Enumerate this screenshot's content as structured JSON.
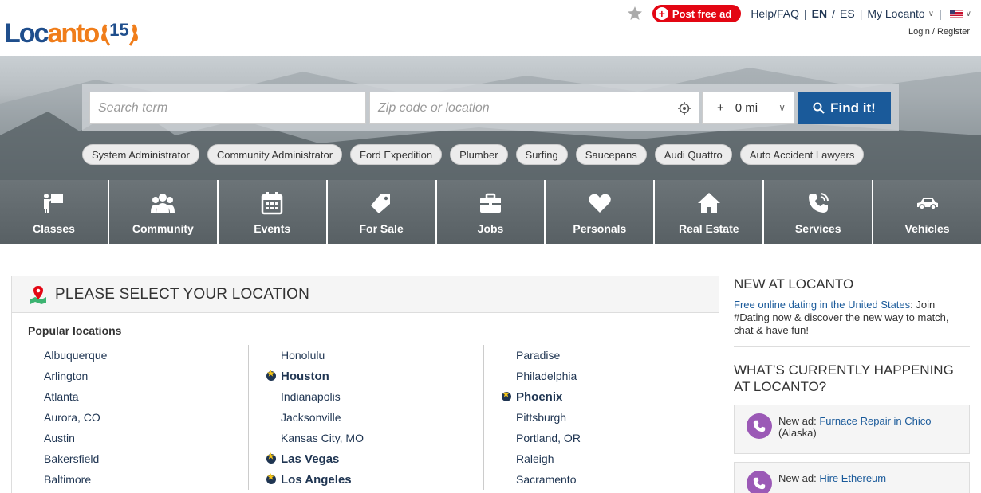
{
  "header": {
    "logo_word_a": "Loc",
    "logo_word_b": "anto",
    "logo_badge": "15",
    "post_ad": "Post free ad",
    "help": "Help/FAQ",
    "lang_en": "EN",
    "lang_es": "ES",
    "my_account": "My Locanto",
    "auth": "Login / Register"
  },
  "search": {
    "term_placeholder": "Search term",
    "location_placeholder": "Zip code or location",
    "radius_plus": "+",
    "radius": "0 mi",
    "button": "Find it!"
  },
  "chips": [
    "System Administrator",
    "Community Administrator",
    "Ford Expedition",
    "Plumber",
    "Surfing",
    "Saucepans",
    "Audi Quattro",
    "Auto Accident Lawyers"
  ],
  "categories": [
    {
      "label": "Classes",
      "icon": "classes-icon"
    },
    {
      "label": "Community",
      "icon": "community-icon"
    },
    {
      "label": "Events",
      "icon": "calendar-icon"
    },
    {
      "label": "For Sale",
      "icon": "tag-icon"
    },
    {
      "label": "Jobs",
      "icon": "briefcase-icon"
    },
    {
      "label": "Personals",
      "icon": "heart-icon"
    },
    {
      "label": "Real Estate",
      "icon": "house-icon"
    },
    {
      "label": "Services",
      "icon": "phone-icon"
    },
    {
      "label": "Vehicles",
      "icon": "car-icon"
    }
  ],
  "location": {
    "title": "PLEASE SELECT YOUR LOCATION",
    "popular": "Popular locations",
    "col1": [
      {
        "name": "Albuquerque",
        "featured": false
      },
      {
        "name": "Arlington",
        "featured": false
      },
      {
        "name": "Atlanta",
        "featured": false
      },
      {
        "name": "Aurora, CO",
        "featured": false
      },
      {
        "name": "Austin",
        "featured": false
      },
      {
        "name": "Bakersfield",
        "featured": false
      },
      {
        "name": "Baltimore",
        "featured": false
      }
    ],
    "col2": [
      {
        "name": "Honolulu",
        "featured": false
      },
      {
        "name": "Houston",
        "featured": true
      },
      {
        "name": "Indianapolis",
        "featured": false
      },
      {
        "name": "Jacksonville",
        "featured": false
      },
      {
        "name": "Kansas City, MO",
        "featured": false
      },
      {
        "name": "Las Vegas",
        "featured": true
      },
      {
        "name": "Los Angeles",
        "featured": true
      }
    ],
    "col3": [
      {
        "name": "Paradise",
        "featured": false
      },
      {
        "name": "Philadelphia",
        "featured": false
      },
      {
        "name": "Phoenix",
        "featured": true
      },
      {
        "name": "Pittsburgh",
        "featured": false
      },
      {
        "name": "Portland, OR",
        "featured": false
      },
      {
        "name": "Raleigh",
        "featured": false
      },
      {
        "name": "Sacramento",
        "featured": false
      }
    ]
  },
  "sidebar": {
    "new_title": "NEW AT LOCANTO",
    "new_link": "Free online dating in the United States",
    "new_text": ": Join #Dating now & discover the new way to match, chat & have fun!",
    "happening_title_1": "WHAT’S CURRENTLY HAPPENING",
    "happening_title_2": "AT LOCANTO?",
    "card1_prefix": "New ad: ",
    "card1_link": "Furnace Repair in Chico",
    "card1_suffix": "(Alaska)",
    "card2_prefix": "New ad: ",
    "card2_link": "Hire Ethereum"
  },
  "colors": {
    "brand_blue": "#1f4e8c",
    "brand_orange": "#f07d1a",
    "post_red": "#e30613",
    "find_blue": "#1a5a9a",
    "link": "#1f3552",
    "purple": "#9b59b6"
  }
}
